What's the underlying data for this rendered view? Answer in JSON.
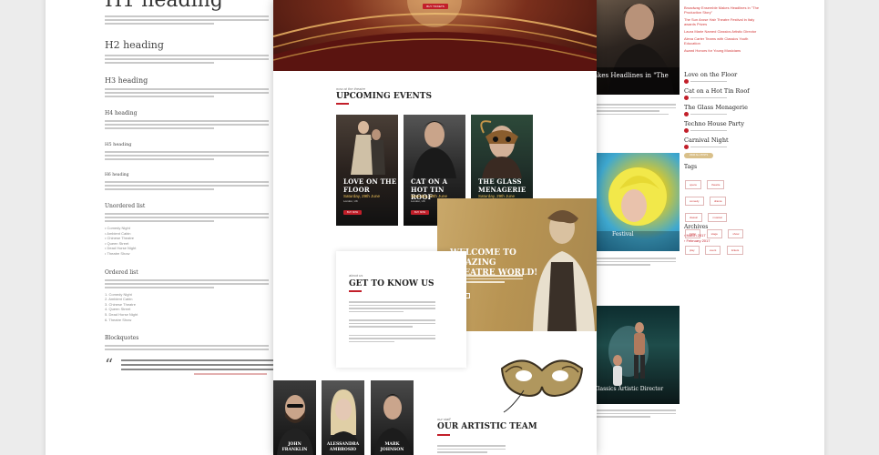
{
  "typography": {
    "h1": "H1 heading",
    "h2": "H2 heading",
    "h3": "H3 heading",
    "h4": "H4 heading",
    "h5": "H5 heading",
    "h6": "H6 heading",
    "unordered_title": "Unordered list",
    "unordered_items": [
      "Comedy Night",
      "Ambient Cabin",
      "Chinese Theatre",
      "Queen Street",
      "Dead Horse Night",
      "Theatre Show"
    ],
    "ordered_title": "Ordered list",
    "ordered_items": [
      "Comedy Night",
      "Ambient Cabin",
      "Chinese Theatre",
      "Queen Street",
      "Dead Horse Night",
      "Theatre Show"
    ],
    "blockquote_title": "Blockquotes"
  },
  "hero": {
    "button_label": "BUY TICKETS"
  },
  "events": {
    "kicker": "now at the theatre",
    "title": "UPCOMING EVENTS",
    "items": [
      {
        "title": "LOVE ON THE FLOOR",
        "date": "Saturday, 29th June",
        "place": "London, UK",
        "button": "BUY NOW"
      },
      {
        "title": "CAT ON A HOT TIN ROOF",
        "date": "Saturday, 29th June",
        "place": "London, UK",
        "button": "BUY NOW"
      },
      {
        "title": "THE GLASS MENAGERIE",
        "date": "Saturday, 29th June",
        "place": "London, UK",
        "button": "BUY NOW"
      }
    ]
  },
  "welcome": {
    "title": "WELCOME TO AMAZING THEATRE WORLD!",
    "button": "READ MORE"
  },
  "about": {
    "kicker": "about us",
    "title": "GET TO KNOW US"
  },
  "team": {
    "kicker": "our staff",
    "title": "OUR ARTISTIC TEAM",
    "members": [
      {
        "first": "JOHN",
        "last": "FRANKLIN"
      },
      {
        "first": "ALESSANDRA",
        "last": "AMBROSIO"
      },
      {
        "first": "MARK",
        "last": "JOHNSON"
      }
    ]
  },
  "sidebar": {
    "recent_links": [
      "Broadway Ensemble Makes Headlines in \"The",
      "Production Story\"",
      "The Sun Arose Hair Theatre Festival in Italy",
      "awards Prizes",
      "Laura Marie Named Classics Artistic Director",
      "Alexa Carter Teams with Classics Youth",
      "Education",
      "Award Honors for Young Musicians"
    ],
    "feature_text": "akes Headlines in \"The",
    "posts": [
      "Love on the Floor",
      "Cat on a Hot Tin Roof",
      "The Glass Menagerie",
      "Techno House Party",
      "Carnival Night"
    ],
    "button_label": "VIEW ALL POSTS",
    "tags_title": "Tags",
    "tags": [
      "opera",
      "theatre",
      "comedy",
      "drama",
      "classic",
      "musical",
      "ballet",
      "stage",
      "show",
      "play",
      "event",
      "tickets"
    ],
    "feature2_text": "Festival",
    "archives_title": "Archives",
    "archives": [
      "March 2017",
      "February 2017"
    ],
    "feature3_text": "Classics Artistic Director"
  },
  "colors": {
    "accent": "#c21f2a",
    "gold": "#d9c08a"
  }
}
